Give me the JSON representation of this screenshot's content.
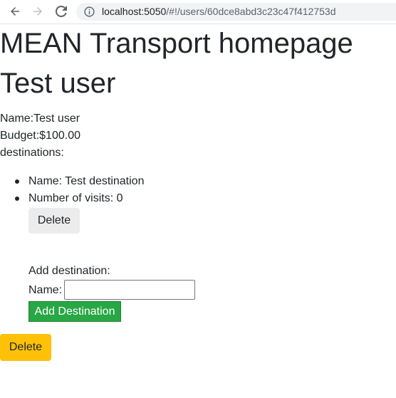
{
  "browser": {
    "url_host": "localhost:5050",
    "url_path": "/#!/users/60dce8abd3c23c47f412753d",
    "icons": [
      "back-arrow-icon",
      "forward-arrow-icon",
      "reload-icon",
      "info-icon"
    ]
  },
  "page": {
    "main_title": "MEAN Transport homepage",
    "user_title": "Test user",
    "name_line": "Name:Test user",
    "budget_line": "Budget:$100.00",
    "destinations_label": "destinations:",
    "destinations": [
      {
        "text": "Name: Test destination"
      },
      {
        "text": "Number of visits: 0"
      }
    ],
    "delete_destination_label": "Delete",
    "add_destination_label": "Add destination:",
    "name_field_label": "Name:",
    "name_field_value": "",
    "add_destination_button": "Add Destination",
    "delete_user_label": "Delete"
  },
  "colors": {
    "success": "#28a745",
    "warning": "#ffc107",
    "light_button": "#ececec"
  }
}
